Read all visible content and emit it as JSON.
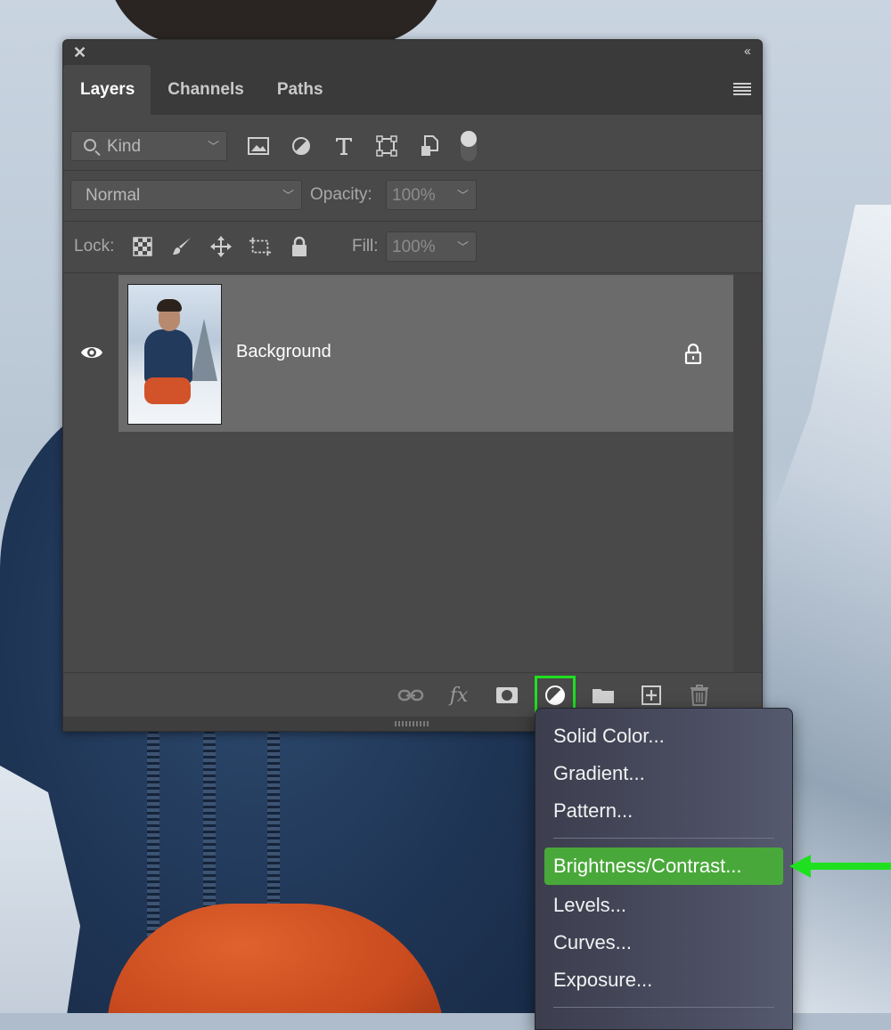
{
  "panel": {
    "tabs": [
      "Layers",
      "Channels",
      "Paths"
    ],
    "filter": {
      "kind_label": "Kind"
    },
    "blend_mode": "Normal",
    "opacity_label": "Opacity:",
    "opacity_value": "100%",
    "lock_label": "Lock:",
    "fill_label": "Fill:",
    "fill_value": "100%",
    "layers": [
      {
        "name": "Background",
        "visible": true,
        "locked": true
      }
    ]
  },
  "adjustment_menu": {
    "items": [
      "Solid Color...",
      "Gradient...",
      "Pattern...",
      "Brightness/Contrast...",
      "Levels...",
      "Curves...",
      "Exposure..."
    ],
    "selected": "Brightness/Contrast..."
  },
  "colors": {
    "highlight_outline": "#1fe01f",
    "menu_selected": "#49a83a",
    "annotation_arrow": "#1fe01f"
  },
  "icons": [
    "close-icon",
    "collapse-icon",
    "panel-menu-icon",
    "search-icon",
    "image-filter-icon",
    "adjustment-filter-icon",
    "type-filter-icon",
    "shape-filter-icon",
    "smart-object-filter-icon",
    "filter-toggle",
    "lock-transparent-icon",
    "lock-paint-icon",
    "lock-position-icon",
    "lock-artboard-icon",
    "lock-all-icon",
    "eye-icon",
    "lock-icon",
    "link-icon",
    "fx-icon",
    "mask-icon",
    "adjustment-layer-icon",
    "folder-icon",
    "new-layer-icon",
    "trash-icon",
    "arrow-icon"
  ]
}
